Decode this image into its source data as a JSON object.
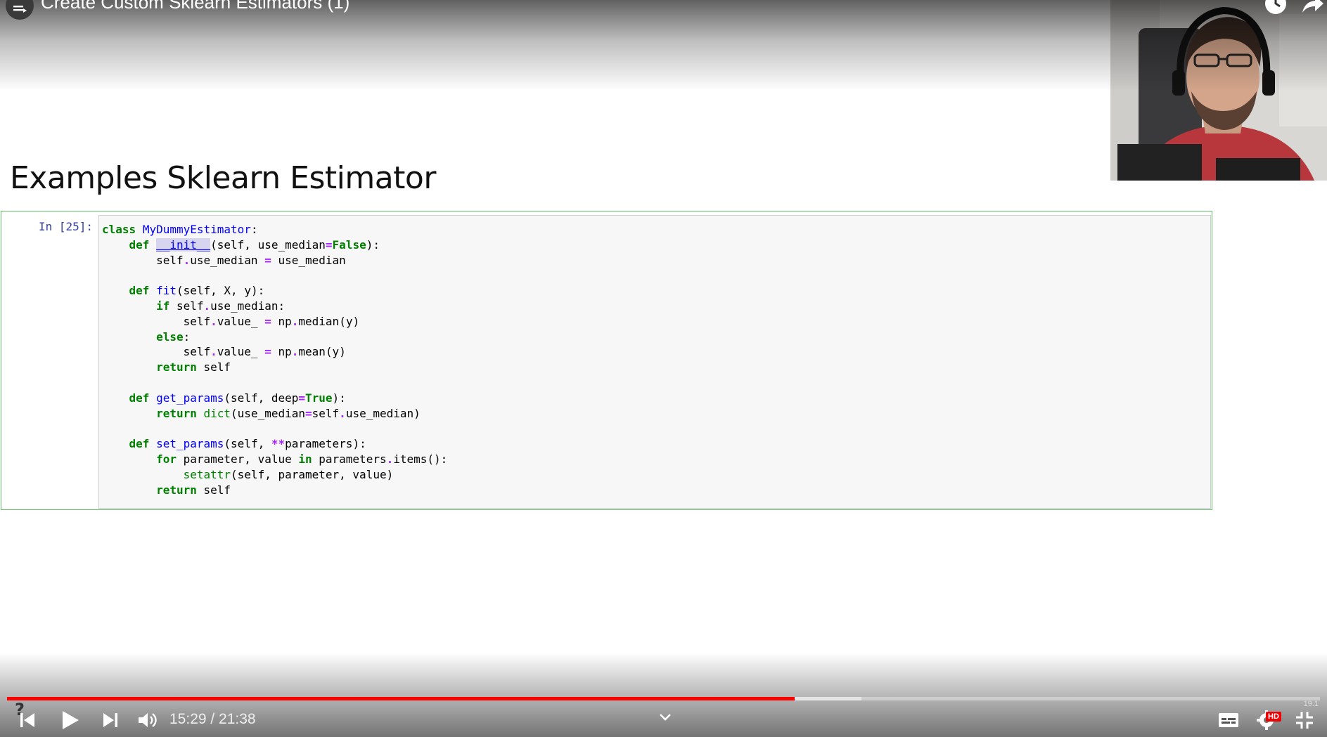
{
  "video": {
    "title": "Create Custom Sklearn Estimators (1)",
    "time_display": "15:29 / 21:38",
    "progress": 0.6,
    "buffered": 0.651,
    "corner_label": "19.1",
    "hd_badge": "HD"
  },
  "notebook": {
    "heading": "Examples Sklearn Estimator",
    "cell_prompt": "In [25]:"
  },
  "colors": {
    "progress": "#ff0000",
    "cell_border": "#66bb6a",
    "keyword": "#008000",
    "function": "#0000ff"
  }
}
